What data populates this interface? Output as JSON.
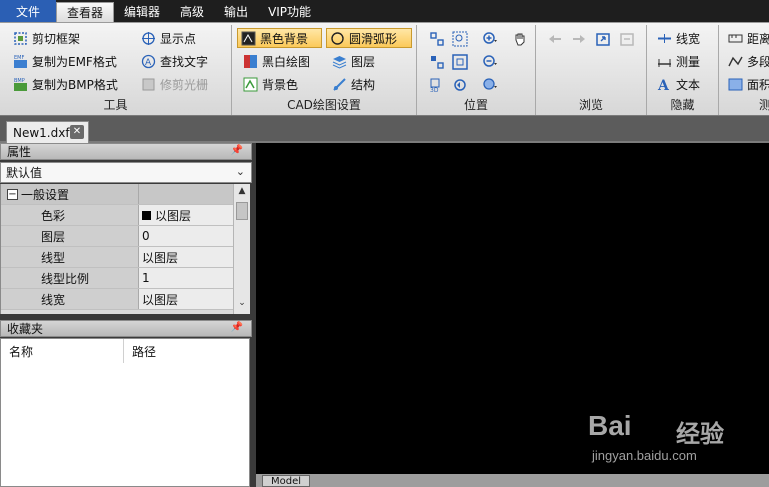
{
  "menu": {
    "file": "文件",
    "viewer": "查看器",
    "editor": "编辑器",
    "advanced": "高级",
    "output": "输出",
    "vip": "VIP功能"
  },
  "ribbon": {
    "tools": {
      "label": "工具",
      "clip_frame": "剪切框架",
      "copy_emf": "复制为EMF格式",
      "copy_bmp": "复制为BMP格式",
      "show_points": "显示点",
      "find_text": "查找文字",
      "trim_raster": "修剪光栅"
    },
    "draw_settings": {
      "label": "CAD绘图设置",
      "black_bg": "黑色背景",
      "smooth_arc": "圆滑弧形",
      "bw_drawing": "黑白绘图",
      "layers": "图层",
      "bg_color": "背景色",
      "structure": "结构"
    },
    "position": {
      "label": "位置"
    },
    "browse": {
      "label": "浏览"
    },
    "hide": {
      "label": "隐藏",
      "linewidth": "线宽",
      "measure": "测量",
      "text": "文本"
    },
    "measure_group": {
      "distance": "距离",
      "polyline": "多段",
      "area": "面积",
      "label": "测"
    }
  },
  "document": {
    "tab_name": "New1.dxf"
  },
  "properties": {
    "title": "属性",
    "selector_value": "默认值",
    "category": "一般设置",
    "rows": [
      {
        "name": "色彩",
        "value": "以图层"
      },
      {
        "name": "图层",
        "value": "0"
      },
      {
        "name": "线型",
        "value": "以图层"
      },
      {
        "name": "线型比例",
        "value": "1"
      },
      {
        "name": "线宽",
        "value": "以图层"
      }
    ]
  },
  "favorites": {
    "title": "收藏夹",
    "col_name": "名称",
    "col_path": "路径"
  },
  "canvas": {
    "layout_tab": "Model",
    "watermark_url": "jingyan.baidu.com",
    "watermark_logo": "Bai",
    "watermark_cn": "经验"
  },
  "colors": {
    "menubar": "#1e1e1e",
    "file_menu": "#2b5fb4",
    "canvas_bg": "#000000",
    "selected_ribbon": "#fbc95a"
  }
}
